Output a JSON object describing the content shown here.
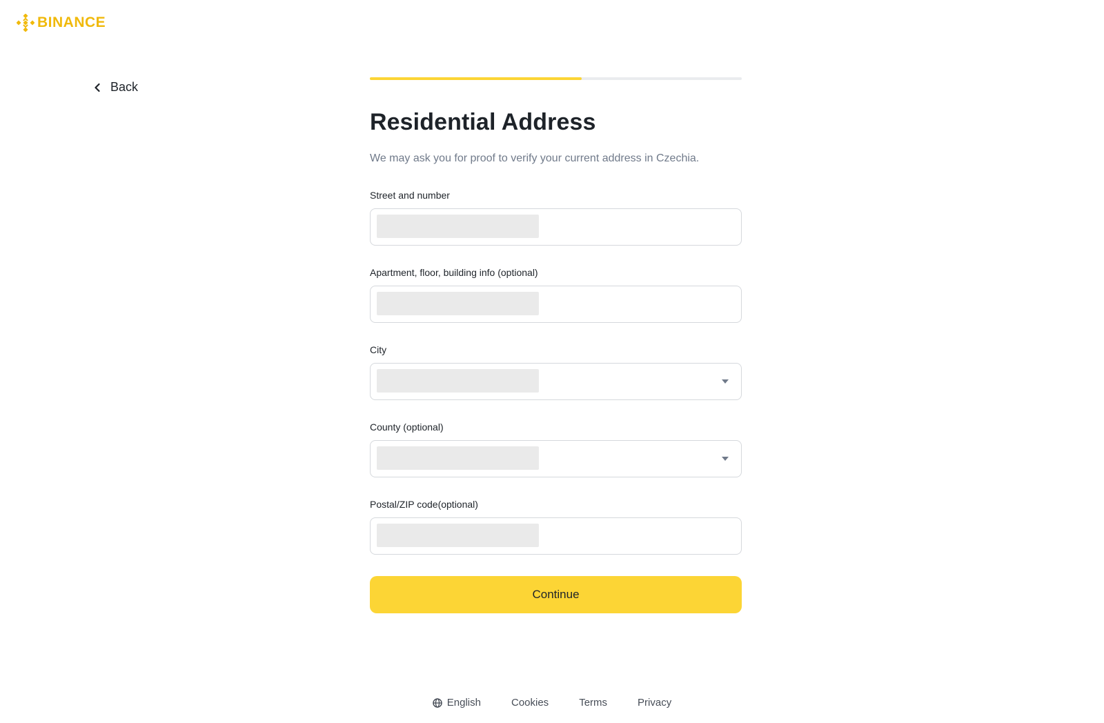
{
  "brand": {
    "name": "BINANCE",
    "color": "#F0B90B",
    "icon": "binance-diamond-icon"
  },
  "nav": {
    "back_label": "Back",
    "back_icon": "chevron-left-icon"
  },
  "progress": {
    "fraction": 0.57,
    "fill_color": "#FCD535",
    "track_color": "#EAECEF"
  },
  "form": {
    "title": "Residential Address",
    "subtitle": "We may ask you for proof to verify your current address in Czechia.",
    "fields": [
      {
        "label": "Street and number",
        "type": "text",
        "value": ""
      },
      {
        "label": "Apartment, floor, building info (optional)",
        "type": "text",
        "value": ""
      },
      {
        "label": "City",
        "type": "select",
        "value": "",
        "icon": "caret-down-icon"
      },
      {
        "label": "County (optional)",
        "type": "select",
        "value": "",
        "icon": "caret-down-icon"
      },
      {
        "label": "Postal/ZIP code(optional)",
        "type": "text",
        "value": ""
      }
    ],
    "submit_label": "Continue",
    "submit_color": "#FCD535"
  },
  "footer": {
    "language": "English",
    "language_icon": "globe-icon",
    "cookies": "Cookies",
    "terms": "Terms",
    "privacy": "Privacy"
  }
}
